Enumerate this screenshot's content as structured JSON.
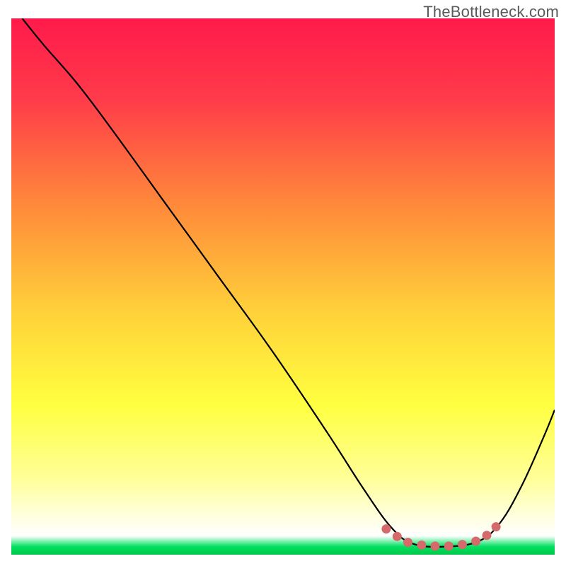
{
  "watermark": "TheBottleneck.com",
  "chart_data": {
    "type": "line",
    "title": "",
    "xlabel": "",
    "ylabel": "",
    "xlim": [
      0,
      100
    ],
    "ylim": [
      0,
      100
    ],
    "background_gradient": [
      {
        "stop": 0.0,
        "color": "#ff1a4b"
      },
      {
        "stop": 0.15,
        "color": "#ff3b4a"
      },
      {
        "stop": 0.35,
        "color": "#ff8a3a"
      },
      {
        "stop": 0.55,
        "color": "#ffd23a"
      },
      {
        "stop": 0.72,
        "color": "#ffff40"
      },
      {
        "stop": 0.86,
        "color": "#ffff9a"
      },
      {
        "stop": 0.93,
        "color": "#ffffe0"
      },
      {
        "stop": 0.965,
        "color": "#ffffff"
      },
      {
        "stop": 0.985,
        "color": "#00e060"
      },
      {
        "stop": 1.0,
        "color": "#00c84a"
      }
    ],
    "series": [
      {
        "name": "bottleneck-curve",
        "color": "#000000",
        "points": [
          {
            "x": 2,
            "y": 100
          },
          {
            "x": 6,
            "y": 95
          },
          {
            "x": 12,
            "y": 88
          },
          {
            "x": 18,
            "y": 80
          },
          {
            "x": 28,
            "y": 66
          },
          {
            "x": 38,
            "y": 52
          },
          {
            "x": 48,
            "y": 38
          },
          {
            "x": 58,
            "y": 23
          },
          {
            "x": 65,
            "y": 12
          },
          {
            "x": 70,
            "y": 5
          },
          {
            "x": 74,
            "y": 2
          },
          {
            "x": 80,
            "y": 1.5
          },
          {
            "x": 86,
            "y": 2.5
          },
          {
            "x": 90,
            "y": 6
          },
          {
            "x": 94,
            "y": 13
          },
          {
            "x": 98,
            "y": 22
          },
          {
            "x": 100,
            "y": 27
          }
        ]
      }
    ],
    "highlight": {
      "name": "optimal-range-dots",
      "color": "#d46a6a",
      "points": [
        {
          "x": 69,
          "y": 4.8
        },
        {
          "x": 71,
          "y": 3.4
        },
        {
          "x": 73,
          "y": 2.3
        },
        {
          "x": 75.5,
          "y": 1.8
        },
        {
          "x": 78,
          "y": 1.6
        },
        {
          "x": 80.5,
          "y": 1.6
        },
        {
          "x": 83,
          "y": 1.9
        },
        {
          "x": 85.5,
          "y": 2.5
        },
        {
          "x": 87.5,
          "y": 3.6
        },
        {
          "x": 89.2,
          "y": 5.2
        }
      ]
    }
  }
}
